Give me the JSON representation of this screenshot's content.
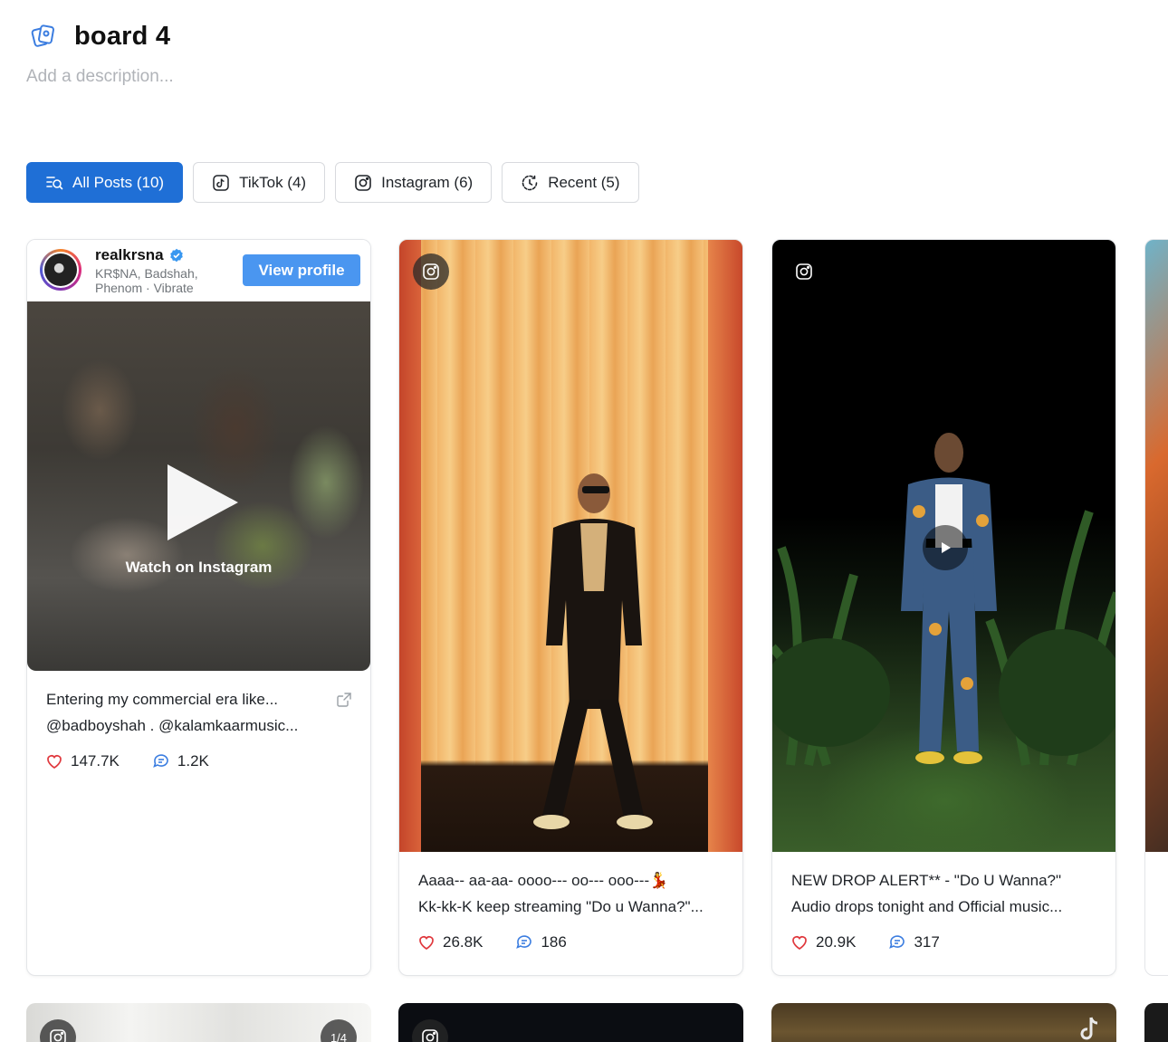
{
  "board": {
    "title": "board 4",
    "description_placeholder": "Add a description..."
  },
  "tabs": [
    {
      "label": "All Posts (10)",
      "icon": "list-search-icon",
      "active": true
    },
    {
      "label": "TikTok (4)",
      "icon": "tiktok-icon",
      "active": false
    },
    {
      "label": "Instagram (6)",
      "icon": "instagram-icon",
      "active": false
    },
    {
      "label": "Recent (5)",
      "icon": "recent-icon",
      "active": false
    }
  ],
  "posts": [
    {
      "platform": "instagram",
      "embed": {
        "username": "realkrsna",
        "subtitle": "KR$NA, Badshah, Phenom · Vibrate",
        "view_profile_label": "View profile",
        "watch_label": "Watch on Instagram"
      },
      "caption_line1": "Entering my commercial era like...",
      "caption_line2": "@badboyshah . @kalamkaarmusic...",
      "likes": "147.7K",
      "comments": "1.2K"
    },
    {
      "platform": "instagram",
      "caption_line1": "Aaaa-- aa-aa- oooo--- oo--- ooo---💃",
      "caption_line2": "Kk-kk-K keep streaming \"Do u Wanna?\"...",
      "likes": "26.8K",
      "comments": "186"
    },
    {
      "platform": "instagram",
      "caption_line1": "NEW DROP ALERT** - \"Do U Wanna?\"",
      "caption_line2": "Audio drops tonight and Official music...",
      "likes": "20.9K",
      "comments": "317"
    }
  ],
  "bottom_row": {
    "first_counter": "1/4"
  },
  "colors": {
    "accent": "#1f6fd6",
    "like": "#e0393e",
    "comment": "#3b7de0",
    "verified": "#3897f0"
  }
}
